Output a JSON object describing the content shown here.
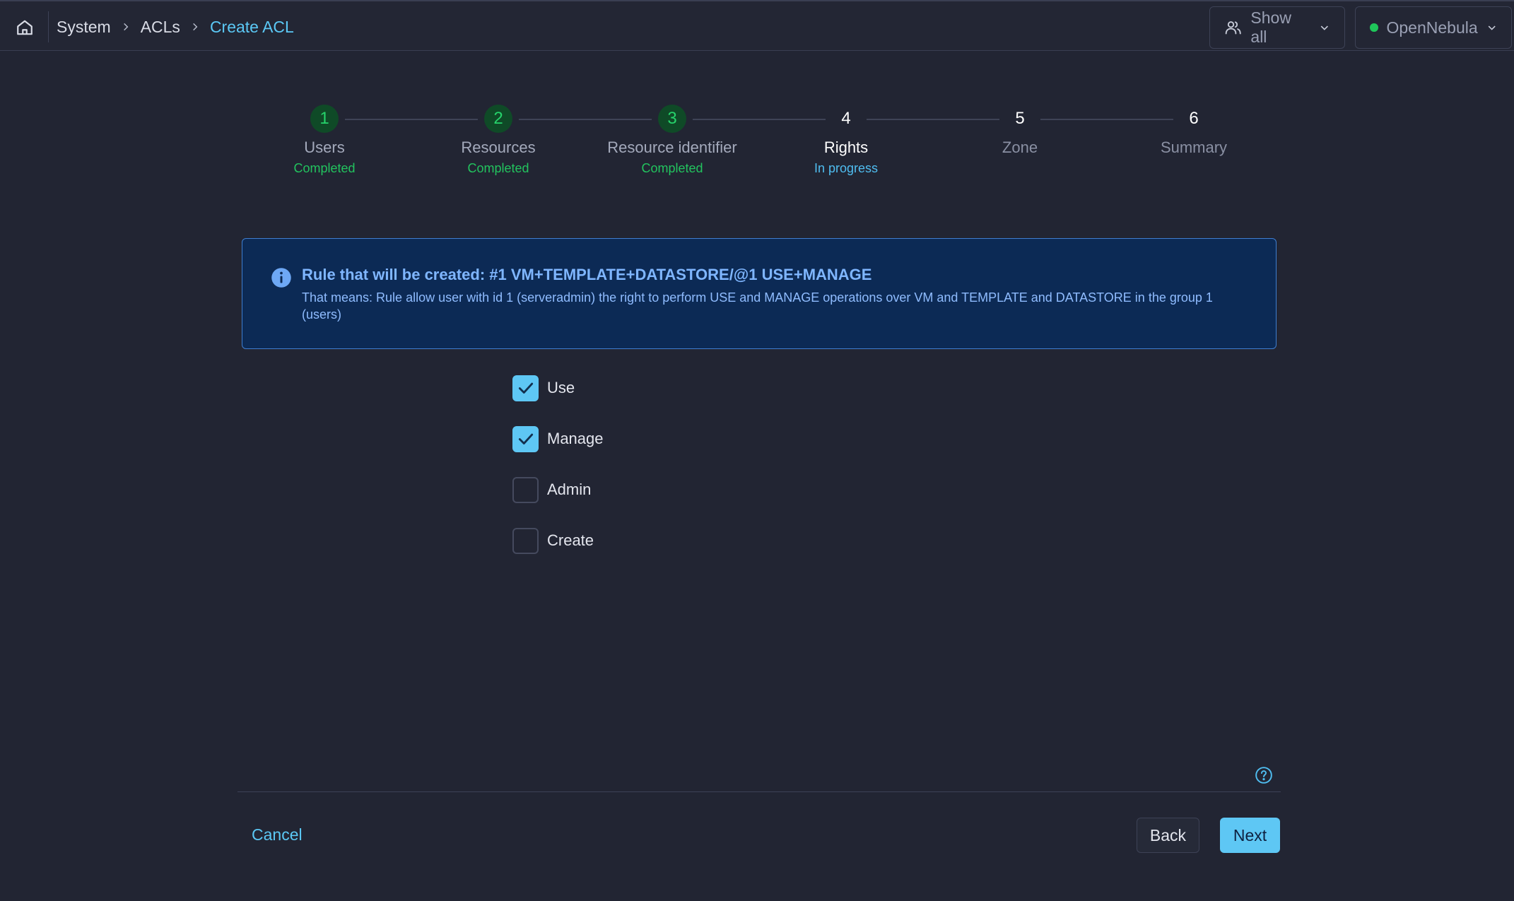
{
  "colors": {
    "background": "#222533",
    "accent": "#5ec7f4",
    "completed": "#22c35e",
    "in_progress": "#4fbdf0",
    "alert_bg": "#0c2a55",
    "online": "#1fc65a"
  },
  "breadcrumb": {
    "home_icon": "home-icon",
    "items": [
      "System",
      "ACLs",
      "Create ACL"
    ]
  },
  "header": {
    "filter_icon": "users-icon",
    "filter_label": "Show all",
    "zone_label": "OpenNebula"
  },
  "stepper": {
    "steps": [
      {
        "number": "1",
        "label": "Users",
        "status": "Completed"
      },
      {
        "number": "2",
        "label": "Resources",
        "status": "Completed"
      },
      {
        "number": "3",
        "label": "Resource identifier",
        "status": "Completed"
      },
      {
        "number": "4",
        "label": "Rights",
        "status": "In progress"
      },
      {
        "number": "5",
        "label": "Zone",
        "status": ""
      },
      {
        "number": "6",
        "label": "Summary",
        "status": ""
      }
    ]
  },
  "alert": {
    "icon": "info-icon",
    "title": "Rule that will be created: #1 VM+TEMPLATE+DATASTORE/@1 USE+MANAGE",
    "description": "That means: Rule allow user with id 1 (serveradmin) the right to perform USE and MANAGE operations over VM and TEMPLATE and DATASTORE in the group 1 (users)"
  },
  "rights": [
    {
      "label": "Use",
      "checked": true
    },
    {
      "label": "Manage",
      "checked": true
    },
    {
      "label": "Admin",
      "checked": false
    },
    {
      "label": "Create",
      "checked": false
    }
  ],
  "footer": {
    "help_icon": "help-circle-icon",
    "cancel_label": "Cancel",
    "back_label": "Back",
    "next_label": "Next"
  }
}
